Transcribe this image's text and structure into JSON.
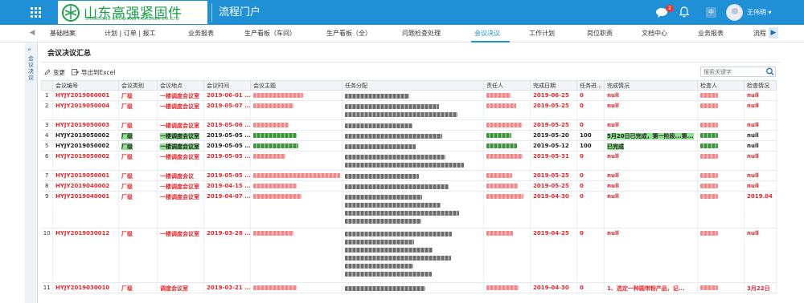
{
  "header": {
    "logo_name": "山东高强紧固件",
    "logo_en": "SHANDONG GAOQIANG FASTENER CO.,LTD",
    "portal_title": "流程门户",
    "notification_count": "2",
    "lang_label": "中",
    "username": "王伟明 ▾"
  },
  "nav": {
    "tabs": [
      "基础档案",
      "计划 | 订单 | 报工",
      "业务报表",
      "生产看板（车间）",
      "生产看板（全）",
      "问题检查处理",
      "会议决议",
      "工作计划",
      "岗位职责",
      "文档中心",
      "业务报表",
      "流程"
    ],
    "active": "会议决议"
  },
  "sidebar": {
    "label": "会议决议"
  },
  "page": {
    "title": "会议决议汇总",
    "toolbar": {
      "edit": "变更",
      "export": "导出到Excel"
    },
    "search_placeholder": "搜索关键字"
  },
  "table": {
    "columns": [
      "",
      "会议编号",
      "会议类别",
      "会议地点",
      "会议时间",
      "会议主题",
      "任务分配",
      "责任人",
      "完成日期",
      "任务进...",
      "完成情况",
      "检查人",
      "检查情况"
    ],
    "rows": [
      {
        "idx": "1",
        "no": "HYJY2019060001",
        "cat": "厂级",
        "place": "一楼调度会议室",
        "time": "2019-06-01 ...",
        "done": "2019-06-25",
        "prog": "0",
        "status": "null",
        "check": "null",
        "lines": 1,
        "green": false
      },
      {
        "idx": "2",
        "no": "HYJY2019050004",
        "cat": "厂级",
        "place": "一楼调度会议室",
        "time": "2019-05-07 ...",
        "done": "2019-05-25",
        "prog": "0",
        "status": "null",
        "check": "null",
        "lines": 2,
        "green": false
      },
      {
        "idx": "3",
        "no": "HYJY2019050003",
        "cat": "厂级",
        "place": "一楼调度会议室",
        "time": "2019-05-06 ...",
        "done": "2019-05-25",
        "prog": "0",
        "status": "null",
        "check": "null",
        "lines": 1,
        "green": false
      },
      {
        "idx": "4",
        "no": "HYJY2019050002",
        "cat": "厂级",
        "place": "一楼调度会议室",
        "time": "2019-05-05 ...",
        "done": "2019-05-20",
        "prog": "100",
        "status": "5月20日已完成，第一阶段...第...",
        "check": "null",
        "lines": 1,
        "green": true
      },
      {
        "idx": "5",
        "no": "HYJY2019050002",
        "cat": "厂级",
        "place": "一楼调度会议室",
        "time": "2019-05-05 ...",
        "done": "2019-05-12",
        "prog": "100",
        "status": "已完成",
        "check": "null",
        "lines": 1,
        "green": true
      },
      {
        "idx": "6",
        "no": "HYJY2019050002",
        "cat": "厂级",
        "place": "一楼调度会议室",
        "time": "2019-05-05 ...",
        "done": "2019-05-31",
        "prog": "0",
        "status": "null",
        "check": "null",
        "lines": 2,
        "green": false
      },
      {
        "idx": "7",
        "no": "HYJY2019050001",
        "cat": "厂级",
        "place": "一楼调度会议",
        "time": "2019-05-05 ...",
        "done": "2019-05-25",
        "prog": "0",
        "status": "null",
        "check": "null",
        "lines": 1,
        "green": false
      },
      {
        "idx": "8",
        "no": "HYJY2019040002",
        "cat": "厂级",
        "place": "一楼调度会议室",
        "time": "2019-04-15 ...",
        "done": "2019-05-25",
        "prog": "0",
        "status": "null",
        "check": "null",
        "lines": 1,
        "green": false
      },
      {
        "idx": "9",
        "no": "HYJY2019040001",
        "cat": "厂级",
        "place": "一楼调度会议室",
        "time": "2019-04-07 ...",
        "done": "2019-04-30",
        "prog": "0",
        "status": "null",
        "check": "2019.04",
        "lines": 4,
        "green": false
      },
      {
        "idx": "10",
        "no": "HYJY2019030012",
        "cat": "厂级",
        "place": "一楼调度会议室",
        "time": "2019-03-28 ...",
        "done": "2019-04-25",
        "prog": "0",
        "status": "null",
        "check": "null",
        "lines": 6,
        "green": false
      },
      {
        "idx": "11",
        "no": "HYJY2019030010",
        "cat": "厂级",
        "place": "调度会议室",
        "time": "2019-03-21 ...",
        "done": "2019-04-30",
        "prog": "0",
        "status": "1、选定一种圆带粉产品，记...",
        "check": "3月22日",
        "lines": 1,
        "green": false
      }
    ]
  },
  "colors": {
    "topbar": "#1f8fd6",
    "red_text": "#e8262b",
    "green_highlight": "#8fe08f",
    "logo_green": "#1a9e4a"
  }
}
